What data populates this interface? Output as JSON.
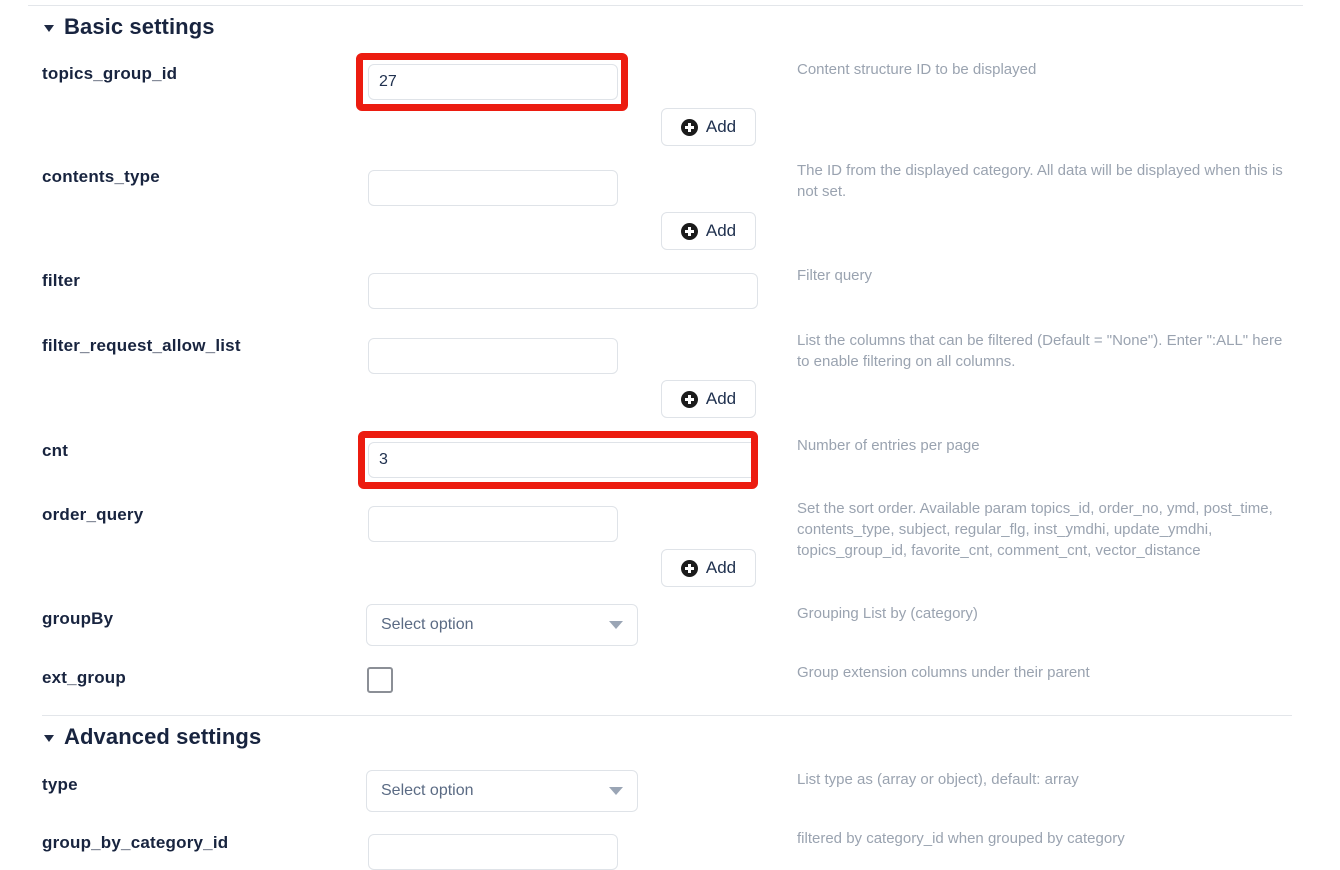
{
  "sections": {
    "basic": {
      "title": "Basic settings",
      "caret": "caret-down-icon"
    },
    "advanced": {
      "title": "Advanced settings",
      "caret": "caret-down-icon"
    }
  },
  "common": {
    "add_label": "Add",
    "add_icon": "plus-circle-icon",
    "select_placeholder": "Select option",
    "dropdown_icon": "chevron-down-icon",
    "highlight_color": "#ec1c10"
  },
  "fields": {
    "topics_group_id": {
      "label": "topics_group_id",
      "value": "27",
      "help": "Content structure ID to be displayed",
      "highlighted": true
    },
    "contents_type": {
      "label": "contents_type",
      "value": "",
      "help": "The ID from the displayed category. All data will be displayed when this is not set."
    },
    "filter": {
      "label": "filter",
      "value": "",
      "help": "Filter query"
    },
    "filter_request_allow_list": {
      "label": "filter_request_allow_list",
      "value": "",
      "help": "List the columns that can be filtered (Default = \"None\"). Enter \":ALL\" here to enable filtering on all columns."
    },
    "cnt": {
      "label": "cnt",
      "value": "3",
      "help": "Number of entries per page",
      "highlighted": true
    },
    "order_query": {
      "label": "order_query",
      "value": "",
      "help": "Set the sort order. Available param topics_id, order_no, ymd, post_time, contents_type, subject, regular_flg, inst_ymdhi, update_ymdhi, topics_group_id, favorite_cnt, comment_cnt, vector_distance"
    },
    "groupBy": {
      "label": "groupBy",
      "value": "Select option",
      "help": "Grouping List by (category)"
    },
    "ext_group": {
      "label": "ext_group",
      "checked": false,
      "help": "Group extension columns under their parent"
    },
    "type": {
      "label": "type",
      "value": "Select option",
      "help": "List type as (array or object), default: array"
    },
    "group_by_category_id": {
      "label": "group_by_category_id",
      "value": "",
      "help": "filtered by category_id when grouped by category"
    }
  }
}
